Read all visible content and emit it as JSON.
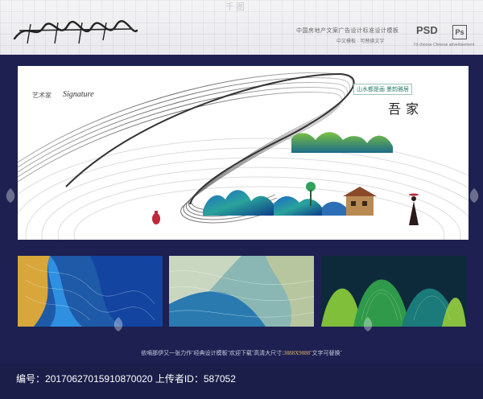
{
  "header": {
    "watermark": "千图",
    "tagline_cn": "中国房地产文案广告设计标准设计模板",
    "tagline_cn2": "中文模板 · 可替换文字",
    "psd_label": "PSD",
    "ps_badge": "Ps",
    "tagline_en": "I'd choose Chinese advertisement"
  },
  "main": {
    "brand_cn": "艺术家",
    "brand_script": "Signature",
    "slogan": "山水都是画 墨韵雅居",
    "title_cn": "吾家"
  },
  "caption": {
    "text_before": "依嘀那伊又一张力作˜经典设计模板˜欢迎下载˜高清大尺寸:",
    "size": "3888X9888",
    "text_after": "˜文字可替换˜"
  },
  "footer": {
    "id_label": "编号：",
    "id_value": "20170627015910870020",
    "uploader_label": "上传者ID：",
    "uploader_value": "587052"
  },
  "colors": {
    "frame": "#1d2050",
    "caption_highlight": "#e8b86a"
  },
  "icons": [
    "leaf-watermark-icon",
    "ps-badge-icon"
  ]
}
